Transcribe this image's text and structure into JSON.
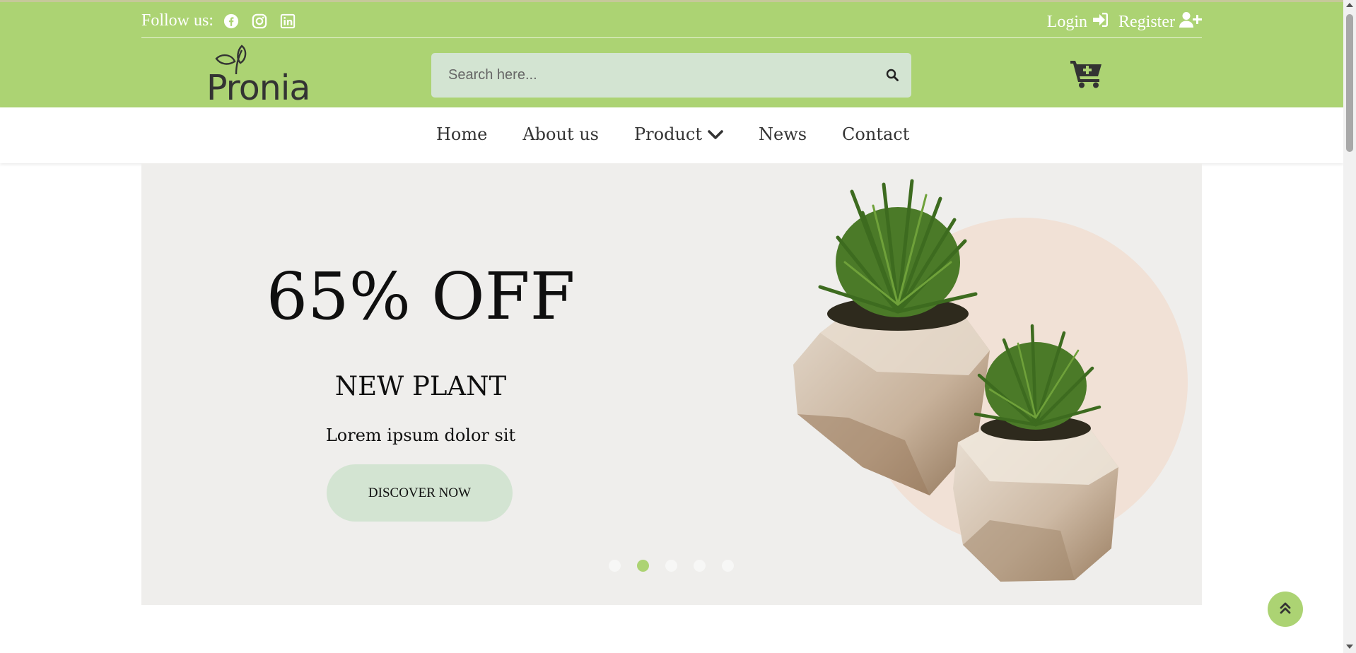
{
  "topbar": {
    "follow_label": "Follow us:",
    "social_icons": [
      "facebook-icon",
      "instagram-icon",
      "linkedin-icon"
    ],
    "login_label": "Login",
    "register_label": "Register"
  },
  "brand": {
    "logo_text": "Pronia"
  },
  "search": {
    "placeholder": "Search here..."
  },
  "nav": {
    "items": [
      {
        "label": "Home"
      },
      {
        "label": "About us"
      },
      {
        "label": "Product"
      },
      {
        "label": "News"
      },
      {
        "label": "Contact"
      }
    ]
  },
  "hero": {
    "headline": "65% OFF",
    "subheadline": "NEW PLANT",
    "text": "Lorem ipsum dolor sit",
    "cta_label": "DISCOVER NOW",
    "slides_total": 5,
    "active_slide": 2
  },
  "colors": {
    "brand_green": "#acd373",
    "search_bg": "#d3e4d2",
    "hero_bg": "#efeeec",
    "text_dark": "#333333"
  }
}
